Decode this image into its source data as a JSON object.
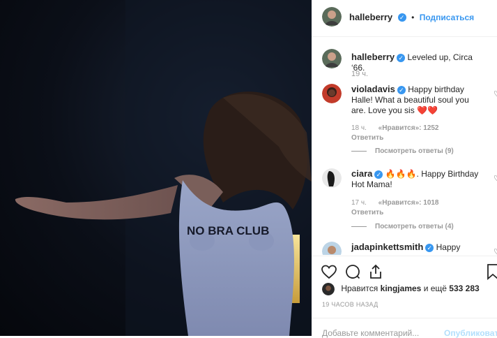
{
  "post": {
    "author": "halleberry",
    "follow_label": "Подписаться",
    "dot": "•",
    "caption": {
      "user": "halleberry",
      "text": "Leveled up, Circa ‘66.",
      "time": "19 ч."
    },
    "shirt_text": "NO BRA CLUB"
  },
  "comments": [
    {
      "user": "violadavis",
      "text": "Happy birthday Halle! What a beautiful soul you are. Love you sis ❤️❤️",
      "time": "18 ч.",
      "likes": "«Нравится»: 1252",
      "reply": "Ответить",
      "view_replies": "Посмотреть ответы (9)"
    },
    {
      "user": "ciara",
      "text": "🔥🔥🔥. Happy Birthday Hot Mama!",
      "time": "17 ч.",
      "likes": "«Нравится»: 1018",
      "reply": "Ответить",
      "view_replies": "Посмотреть ответы (4)"
    },
    {
      "user": "jadapinkettsmith",
      "text": "Happy"
    }
  ],
  "likes": {
    "prefix": "Нравится",
    "user": "kingjames",
    "middle": "и ещё",
    "count": "533 283"
  },
  "time_ago": "19 ЧАСОВ НАЗАД",
  "add_comment": {
    "placeholder": "Добавьте комментарий...",
    "publish": "Опубликовать"
  },
  "icons": {
    "like": "heart-icon",
    "comment": "comment-icon",
    "share": "share-icon",
    "save": "bookmark-icon",
    "verified": "verified-icon",
    "comment_like": "small-heart-icon"
  },
  "colors": {
    "link": "#3897f0",
    "muted": "#999999",
    "text": "#262626"
  }
}
